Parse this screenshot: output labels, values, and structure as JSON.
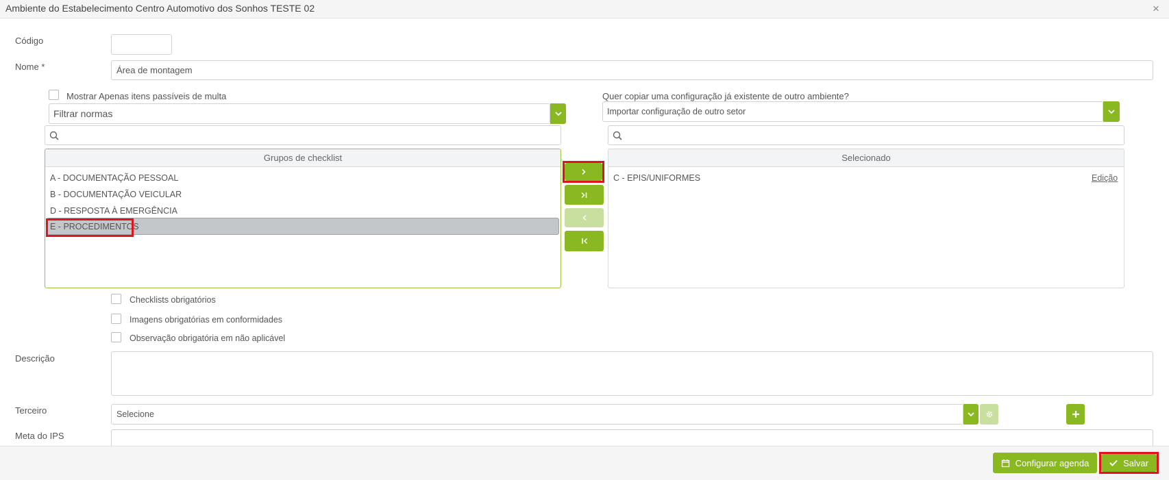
{
  "window": {
    "title": "Ambiente do Estabelecimento Centro Automotivo dos Sonhos TESTE 02",
    "close": "×"
  },
  "form": {
    "codigo_label": "Código",
    "codigo_value": "",
    "nome_label": "Nome",
    "nome_required": "*",
    "nome_value": "Área de montagem",
    "multa_label": "Mostrar Apenas itens passíveis de multa",
    "filtrar_placeholder": "Filtrar normas",
    "copy_question": "Quer copiar uma configuração já existente de outro ambiente?",
    "importar_placeholder": "Importar configuração de outro setor"
  },
  "left_panel": {
    "header": "Grupos de checklist",
    "items": [
      "A - DOCUMENTAÇÃO PESSOAL",
      "B - DOCUMENTAÇÃO VEICULAR",
      "D - RESPOSTA À EMERGÊNCIA",
      "E - PROCEDIMENTOS"
    ],
    "selected_index": 3
  },
  "right_panel": {
    "header": "Selecionado",
    "items": [
      {
        "label": "C - EPIS/UNIFORMES",
        "action": "Edição"
      }
    ]
  },
  "transfer_buttons": {
    "move_one": "›",
    "move_all": "⇥",
    "remove_one": "‹",
    "remove_all": "⇤"
  },
  "options": {
    "checklists_obrigatorios": "Checklists obrigatórios",
    "imagens_obrigatorias": "Imagens obrigatórias em conformidades",
    "observacao_obrigatoria": "Observação obrigatória em não aplicável"
  },
  "descricao_label": "Descrição",
  "terceiro": {
    "label": "Terceiro",
    "placeholder": "Selecione"
  },
  "meta_label": "Meta do IPS",
  "footer": {
    "configurar_agenda": "Configurar agenda",
    "salvar": "Salvar"
  },
  "colors": {
    "accent": "#89b820",
    "accent_disabled": "#c9dfa0",
    "highlight": "#e0141e",
    "selected_row": "#c3c7ca"
  }
}
